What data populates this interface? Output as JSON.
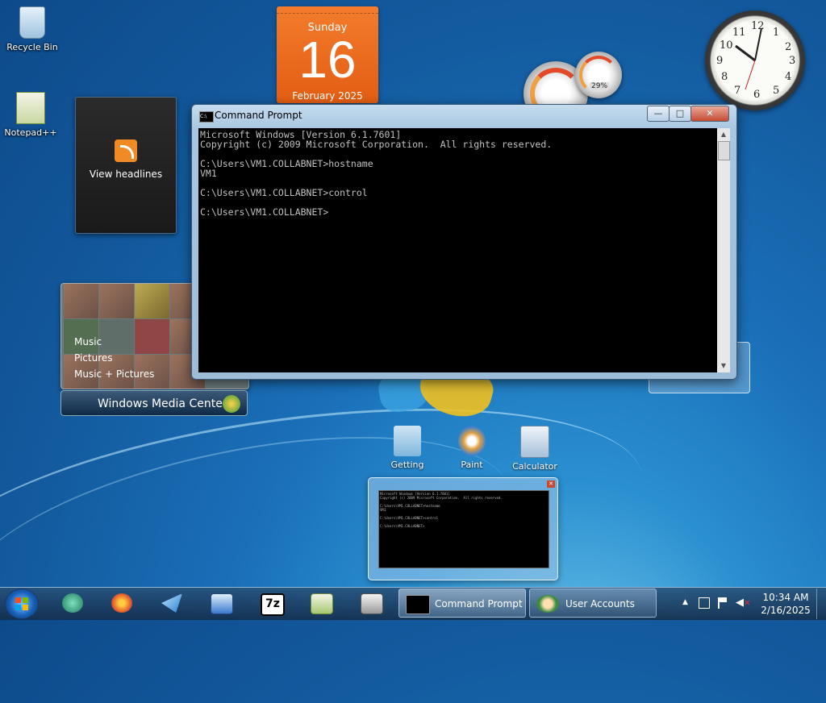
{
  "desktop": {
    "icons": [
      {
        "label": "Recycle Bin"
      },
      {
        "label": "Notepad++"
      }
    ],
    "shortcuts": [
      {
        "label": "Getting"
      },
      {
        "label": "Paint"
      },
      {
        "label": "Calculator"
      }
    ]
  },
  "gadgets": {
    "calendar": {
      "day": "Sunday",
      "date": "16",
      "month": "February 2025"
    },
    "feed": {
      "label": "View headlines"
    },
    "cpu_meter": {
      "memory_percent": "29%"
    },
    "clock": {
      "numerals": [
        "12",
        "1",
        "2",
        "3",
        "4",
        "5",
        "6",
        "7",
        "8",
        "9",
        "10",
        "11"
      ]
    },
    "media_center": {
      "items": [
        "Music",
        "Pictures",
        "Music + Pictures"
      ],
      "title": "Windows Media Center"
    }
  },
  "command_prompt": {
    "title": "Command Prompt",
    "lines": [
      "Microsoft Windows [Version 6.1.7601]",
      "Copyright (c) 2009 Microsoft Corporation.  All rights reserved.",
      "",
      "C:\\Users\\VM1.COLLABNET>hostname",
      "VM1",
      "",
      "C:\\Users\\VM1.COLLABNET>control",
      "",
      "C:\\Users\\VM1.COLLABNET>"
    ],
    "buttons": {
      "minimize": "—",
      "maximize": "□",
      "close": "✕"
    }
  },
  "taskbar": {
    "pinned": [
      {
        "icon": "browser-icon",
        "color": "#2a9a7a"
      },
      {
        "icon": "firefox-icon",
        "color": "#e8622a"
      },
      {
        "icon": "send-icon",
        "color": "#4aa0e0"
      },
      {
        "icon": "remote-desktop-icon",
        "color": "#3a7ad0"
      },
      {
        "icon": "7zip-icon",
        "color": "#ffffff"
      },
      {
        "icon": "notepadpp-icon",
        "color": "#8ab040"
      },
      {
        "icon": "printer-icon",
        "color": "#c0c0c0"
      }
    ],
    "tasks": [
      {
        "label": "Command Prompt"
      },
      {
        "label": "User Accounts"
      }
    ],
    "clock": {
      "time": "10:34 AM",
      "date": "2/16/2025"
    },
    "tray": {
      "show_hidden": "▲"
    }
  }
}
